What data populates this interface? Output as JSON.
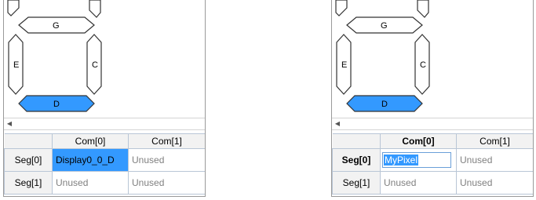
{
  "colors": {
    "segment_highlight": "#3399ff",
    "grid_border": "#b9c6d6",
    "unused_text": "#808080"
  },
  "left_panel": {
    "segments": {
      "g": "G",
      "e": "E",
      "c": "C",
      "d": "D"
    },
    "grid": {
      "columns": [
        "Com[0]",
        "Com[1]"
      ],
      "rows": [
        {
          "header": "Seg[0]",
          "cells": [
            "Display0_0_D",
            "Unused"
          ]
        },
        {
          "header": "Seg[1]",
          "cells": [
            "Unused",
            "Unused"
          ]
        }
      ]
    }
  },
  "right_panel": {
    "segments": {
      "g": "G",
      "e": "E",
      "c": "C",
      "d": "D"
    },
    "grid": {
      "columns": [
        "Com[0]",
        "Com[1]"
      ],
      "rows": [
        {
          "header": "Seg[0]",
          "cells": [
            "MyPixel",
            "Unused"
          ]
        },
        {
          "header": "Seg[1]",
          "cells": [
            "Unused",
            "Unused"
          ]
        }
      ]
    }
  }
}
